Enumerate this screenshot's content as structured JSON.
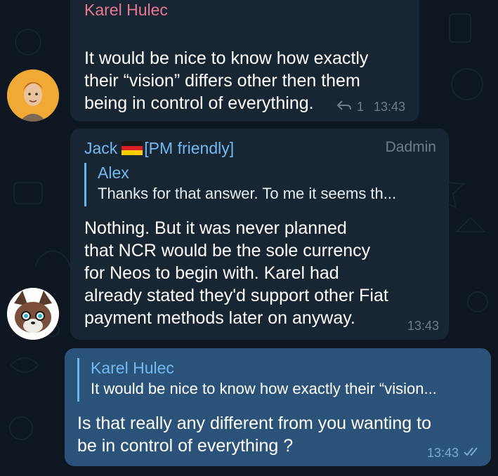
{
  "messages": [
    {
      "sender": "Karel Hulec",
      "text": "It would be nice to know how exactly\ntheir “vision” differs other then them\nbeing in control of everything.",
      "emoji": "grinning-face-emoji",
      "replies_count": "1",
      "time": "13:43",
      "colors": {
        "sender": "#e8798f"
      }
    },
    {
      "sender": "Jack",
      "flag": "germany-flag-icon",
      "sender_suffix": "[PM friendly]",
      "role": "Dadmin",
      "reply_to": {
        "name": "Alex",
        "text": "Thanks for that answer. To me it seems th..."
      },
      "text": "Nothing. But it was never planned\nthat NCR would be the sole currency\nfor Neos to begin with. Karel had\nalready stated they'd support other Fiat\npayment methods later on anyway.",
      "time": "13:43",
      "colors": {
        "sender": "#71baf2"
      }
    },
    {
      "outgoing": true,
      "reply_to": {
        "name": "Karel Hulec",
        "text": "It would be nice to know how exactly their “vision..."
      },
      "text": "Is that really any different from you wanting to\nbe in control of everything ?",
      "time": "13:43",
      "status_icon": "double-check-icon",
      "colors": {
        "bubble": "#2b5278"
      }
    }
  ],
  "colors": {
    "background": "#0e1621",
    "incoming_bubble": "#182533",
    "outgoing_bubble": "#2b5278",
    "meta": "#6d7f8f",
    "reply_accent": "#64b5ef"
  }
}
